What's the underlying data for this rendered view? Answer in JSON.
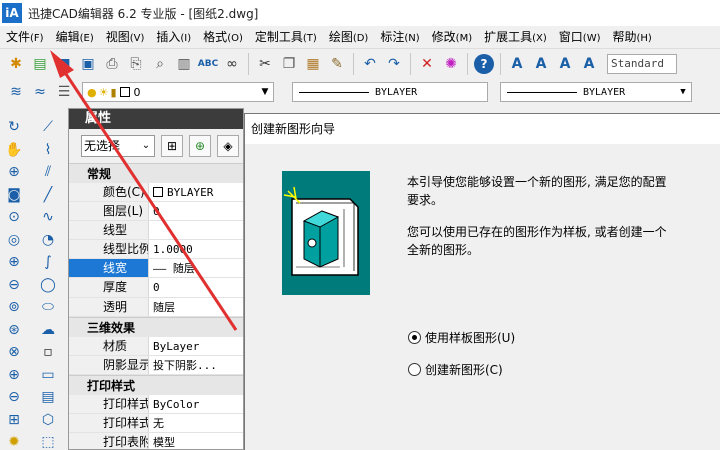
{
  "window": {
    "logo": "iA",
    "title": "迅捷CAD编辑器 6.2 专业版  - [图纸2.dwg]"
  },
  "menu": [
    {
      "label": "文件",
      "acc": "(F)"
    },
    {
      "label": "编辑",
      "acc": "(E)"
    },
    {
      "label": "视图",
      "acc": "(V)"
    },
    {
      "label": "插入",
      "acc": "(I)"
    },
    {
      "label": "格式",
      "acc": "(O)"
    },
    {
      "label": "定制工具",
      "acc": "(T)"
    },
    {
      "label": "绘图",
      "acc": "(D)"
    },
    {
      "label": "标注",
      "acc": "(N)"
    },
    {
      "label": "修改",
      "acc": "(M)"
    },
    {
      "label": "扩展工具",
      "acc": "(X)"
    },
    {
      "label": "窗口",
      "acc": "(W)"
    },
    {
      "label": "帮助",
      "acc": "(H)"
    }
  ],
  "toolbar": {
    "text_style": "Standard",
    "layer_value": "0",
    "color_value": "BYLAYER",
    "linetype_value": "BYLAYER"
  },
  "properties": {
    "title": "属性",
    "selection": "无选择",
    "sections": {
      "general": {
        "header": "常规",
        "rows": [
          {
            "key": "颜色(C)",
            "value": "BYLAYER"
          },
          {
            "key": "图层(L)",
            "value": "0"
          },
          {
            "key": "线型",
            "value": ""
          },
          {
            "key": "线型比例",
            "value": "1.0000"
          },
          {
            "key": "线宽",
            "value": "—— 随层"
          },
          {
            "key": "厚度",
            "value": "0"
          },
          {
            "key": "透明",
            "value": "随层"
          }
        ]
      },
      "3d": {
        "header": "三维效果",
        "rows": [
          {
            "key": "材质",
            "value": "ByLayer"
          },
          {
            "key": "阴影显示",
            "value": "投下阴影..."
          }
        ]
      },
      "plot": {
        "header": "打印样式",
        "rows": [
          {
            "key": "打印样式",
            "value": "ByColor"
          },
          {
            "key": "打印样式表",
            "value": "无"
          },
          {
            "key": "打印表附加到",
            "value": "模型"
          }
        ]
      }
    }
  },
  "wizard": {
    "title": "创建新图形向导",
    "intro1": "本引导使您能够设置一个新的图形, 满足您的配置要求。",
    "intro2": "您可以使用已存在的图形作为样板, 或者创建一个全新的图形。",
    "option_template": "使用样板图形(U)",
    "option_new": "创建新图形(C)"
  }
}
